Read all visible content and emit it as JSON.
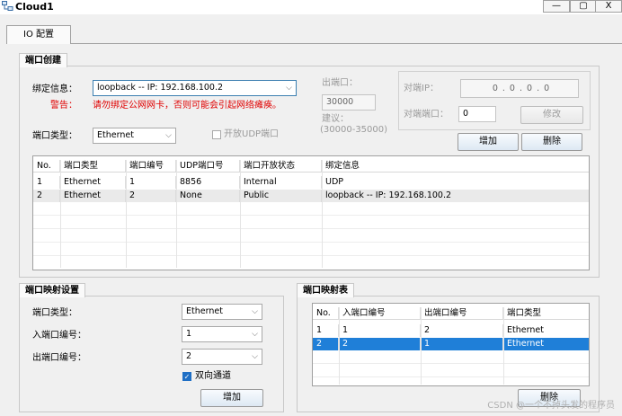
{
  "window": {
    "title": "Cloud1",
    "minimize_glyph": "—",
    "maximize_glyph": "▢",
    "close_glyph": "X"
  },
  "tabs": [
    {
      "label": "IO 配置"
    }
  ],
  "port_create": {
    "title": "端口创建",
    "bind_label": "绑定信息：",
    "bind_value": "loopback -- IP: 192.168.100.2",
    "warning_label": "警告：",
    "warning_text": "请勿绑定公网网卡，否则可能会引起网络瘫痪。",
    "port_type_label": "端口类型：",
    "port_type_value": "Ethernet",
    "open_udp_label": "开放UDP端口",
    "out_port_label": "出端口：",
    "out_port_value": "30000",
    "suggest_label": "建议：",
    "suggest_range": "(30000-35000)",
    "peer_ip_label": "对端IP：",
    "peer_ip_value": "0 . 0 . 0 . 0",
    "peer_port_label": "对端端口：",
    "peer_port_value": "0",
    "modify_button": "修改",
    "add_button": "增加",
    "delete_button": "删除",
    "table": {
      "headers": [
        "No.",
        "端口类型",
        "端口编号",
        "UDP端口号",
        "端口开放状态",
        "绑定信息"
      ],
      "rows": [
        [
          "1",
          "Ethernet",
          "1",
          "8856",
          "Internal",
          "UDP"
        ],
        [
          "2",
          "Ethernet",
          "2",
          "None",
          "Public",
          "loopback -- IP: 192.168.100.2"
        ]
      ]
    }
  },
  "port_map_settings": {
    "title": "端口映射设置",
    "port_type_label": "端口类型：",
    "port_type_value": "Ethernet",
    "in_port_label": "入端口编号：",
    "in_port_value": "1",
    "out_port_label": "出端口编号：",
    "out_port_value": "2",
    "bidirectional_label": "双向通道",
    "bidirectional_checked": true,
    "add_button": "增加"
  },
  "port_map_table": {
    "title": "端口映射表",
    "headers": [
      "No.",
      "入端口编号",
      "出端口编号",
      "端口类型"
    ],
    "rows": [
      [
        "1",
        "1",
        "2",
        "Ethernet"
      ],
      [
        "2",
        "2",
        "1",
        "Ethernet"
      ]
    ],
    "selected_row": 2,
    "delete_button": "删除"
  },
  "watermark": "CSDN @一个不掉头发的程序员",
  "colors": {
    "selection": "#1f7fd8",
    "warning": "#e00000",
    "disabled_text": "#9a9a9a"
  }
}
